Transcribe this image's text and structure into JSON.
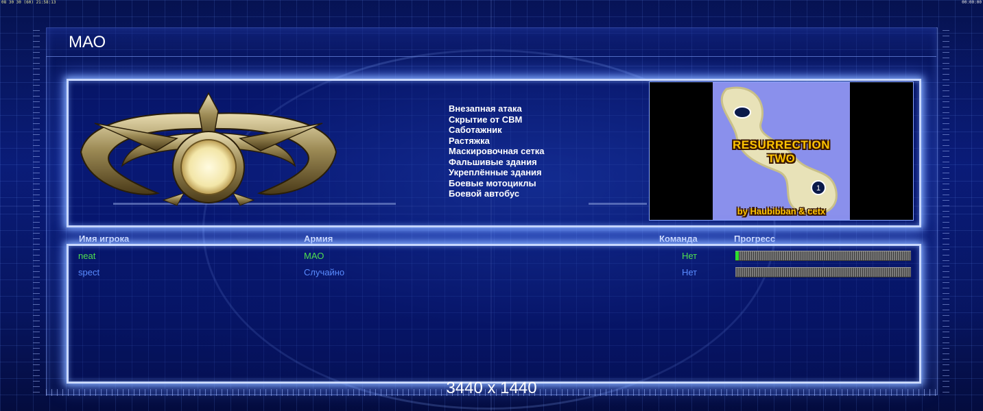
{
  "overlay": {
    "stats_left": "08 30 30 (60) 21:58:13",
    "stats_right": "00:00:00"
  },
  "lobby": {
    "title": "МАО",
    "features": [
      "Внезапная атака",
      "Скрытие от СВМ",
      "Саботажник",
      "Растяжка",
      "Маскировочная сетка",
      "Фальшивые здания",
      "Укреплённые здания",
      "Боевые мотоциклы",
      "Боевой автобус"
    ],
    "map_preview": {
      "title_line1": "RESURRECTION",
      "title_line2": "TWO",
      "credit": "by Haubibban & cetx",
      "start_marker": "1",
      "water_color": "#8a90ec",
      "land_color": "#e8e2b8",
      "title_color": "#ffc400"
    },
    "columns": {
      "player": "Имя игрока",
      "army": "Армия",
      "team": "Команда",
      "progress": "Прогресс"
    },
    "players": [
      {
        "name": "neat",
        "army": "МАО",
        "team": "Нет",
        "progress": 0.02,
        "color": "#4fe04f"
      },
      {
        "name": "spect",
        "army": "Случайно",
        "team": "Нет",
        "progress": 0.0,
        "color": "#5a8cff"
      }
    ]
  },
  "resolution_label": "3440 x 1440"
}
